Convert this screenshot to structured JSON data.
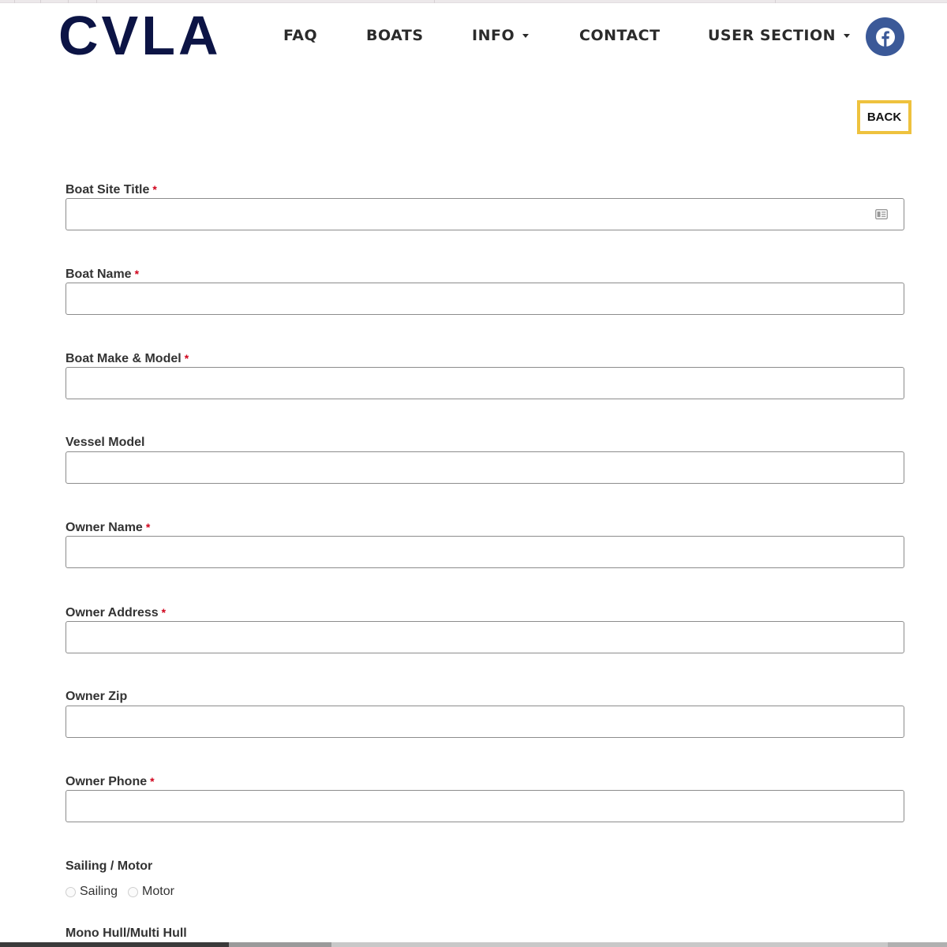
{
  "logo": {
    "text": "CVLA",
    "color": "#0c1445"
  },
  "nav": {
    "items": [
      {
        "label": "FAQ",
        "has_dropdown": false
      },
      {
        "label": "BOATS",
        "has_dropdown": false
      },
      {
        "label": "INFO",
        "has_dropdown": true
      },
      {
        "label": "CONTACT",
        "has_dropdown": false
      },
      {
        "label": "USER SECTION",
        "has_dropdown": true
      }
    ],
    "social": {
      "icon": "facebook-icon",
      "color": "#3b5998"
    }
  },
  "back_button": {
    "label": "BACK",
    "border_color": "#eec23e"
  },
  "form": {
    "required_marker": "*",
    "required_color": "#d0021b",
    "fields": [
      {
        "label": "Boat Site Title",
        "required": true,
        "value": "",
        "placeholder": "",
        "icon": "contact-card-icon"
      },
      {
        "label": "Boat Name",
        "required": true,
        "value": "",
        "placeholder": ""
      },
      {
        "label": "Boat Make & Model",
        "required": true,
        "value": "",
        "placeholder": ""
      },
      {
        "label": "Vessel Model",
        "required": false,
        "value": "",
        "placeholder": ""
      },
      {
        "label": "Owner Name",
        "required": true,
        "value": "",
        "placeholder": ""
      },
      {
        "label": "Owner Address",
        "required": true,
        "value": "",
        "placeholder": ""
      },
      {
        "label": "Owner Zip",
        "required": false,
        "value": "",
        "placeholder": ""
      },
      {
        "label": "Owner Phone",
        "required": true,
        "value": "",
        "placeholder": ""
      }
    ],
    "sailing_motor": {
      "label": "Sailing / Motor",
      "options": [
        {
          "label": "Sailing",
          "checked": false
        },
        {
          "label": "Motor",
          "checked": false
        }
      ]
    },
    "hull": {
      "label": "Mono Hull/Multi Hull"
    }
  }
}
